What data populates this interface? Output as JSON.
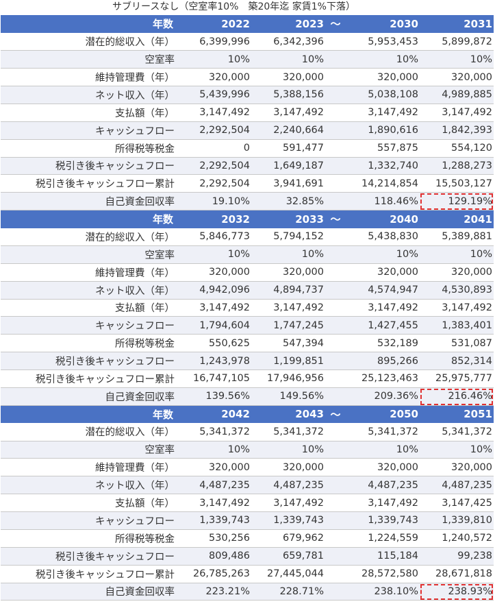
{
  "title": "サブリースなし（空室率10%　築20年迄 家賃1%下落）",
  "header_label": "年数",
  "gap_symbol": "～",
  "row_labels": [
    "潜在的総収入（年）",
    "空室率",
    "維持管理費（年）",
    "ネット収入（年）",
    "支払額（年）",
    "キャッシュフロー",
    "所得税等税金",
    "税引き後キャッシュフロー",
    "税引き後キャッシュフロー累計",
    "自己資金回収率"
  ],
  "sections": [
    {
      "years": [
        "2022",
        "2023",
        "2030",
        "2031"
      ],
      "rows": [
        [
          "6,399,996",
          "6,342,396",
          "5,953,453",
          "5,899,872"
        ],
        [
          "10%",
          "10%",
          "10%",
          "10%"
        ],
        [
          "320,000",
          "320,000",
          "320,000",
          "320,000"
        ],
        [
          "5,439,996",
          "5,388,156",
          "5,038,108",
          "4,989,885"
        ],
        [
          "3,147,492",
          "3,147,492",
          "3,147,492",
          "3,147,492"
        ],
        [
          "2,292,504",
          "2,240,664",
          "1,890,616",
          "1,842,393"
        ],
        [
          "0",
          "591,477",
          "557,875",
          "554,120"
        ],
        [
          "2,292,504",
          "1,649,187",
          "1,332,740",
          "1,288,273"
        ],
        [
          "2,292,504",
          "3,941,691",
          "14,214,854",
          "15,503,127"
        ],
        [
          "19.10%",
          "32.85%",
          "118.46%",
          "129.19%"
        ]
      ]
    },
    {
      "years": [
        "2032",
        "2033",
        "2040",
        "2041"
      ],
      "rows": [
        [
          "5,846,773",
          "5,794,152",
          "5,438,830",
          "5,389,881"
        ],
        [
          "10%",
          "10%",
          "10%",
          "10%"
        ],
        [
          "320,000",
          "320,000",
          "320,000",
          "320,000"
        ],
        [
          "4,942,096",
          "4,894,737",
          "4,574,947",
          "4,530,893"
        ],
        [
          "3,147,492",
          "3,147,492",
          "3,147,492",
          "3,147,492"
        ],
        [
          "1,794,604",
          "1,747,245",
          "1,427,455",
          "1,383,401"
        ],
        [
          "550,625",
          "547,394",
          "532,189",
          "531,087"
        ],
        [
          "1,243,978",
          "1,199,851",
          "895,266",
          "852,314"
        ],
        [
          "16,747,105",
          "17,946,956",
          "25,123,463",
          "25,975,777"
        ],
        [
          "139.56%",
          "149.56%",
          "209.36%",
          "216.46%"
        ]
      ]
    },
    {
      "years": [
        "2042",
        "2043",
        "2050",
        "2051"
      ],
      "rows": [
        [
          "5,341,372",
          "5,341,372",
          "5,341,372",
          "5,341,372"
        ],
        [
          "10%",
          "10%",
          "10%",
          "10%"
        ],
        [
          "320,000",
          "320,000",
          "320,000",
          "320,000"
        ],
        [
          "4,487,235",
          "4,487,235",
          "4,487,235",
          "4,487,235"
        ],
        [
          "3,147,492",
          "3,147,492",
          "3,147,492",
          "3,147,425"
        ],
        [
          "1,339,743",
          "1,339,743",
          "1,339,743",
          "1,339,810"
        ],
        [
          "530,256",
          "679,962",
          "1,224,559",
          "1,240,572"
        ],
        [
          "809,486",
          "659,781",
          "115,184",
          "99,238"
        ],
        [
          "26,785,263",
          "27,445,044",
          "28,572,580",
          "28,671,818"
        ],
        [
          "223.21%",
          "228.71%",
          "238.10%",
          "238.93%"
        ]
      ]
    }
  ]
}
